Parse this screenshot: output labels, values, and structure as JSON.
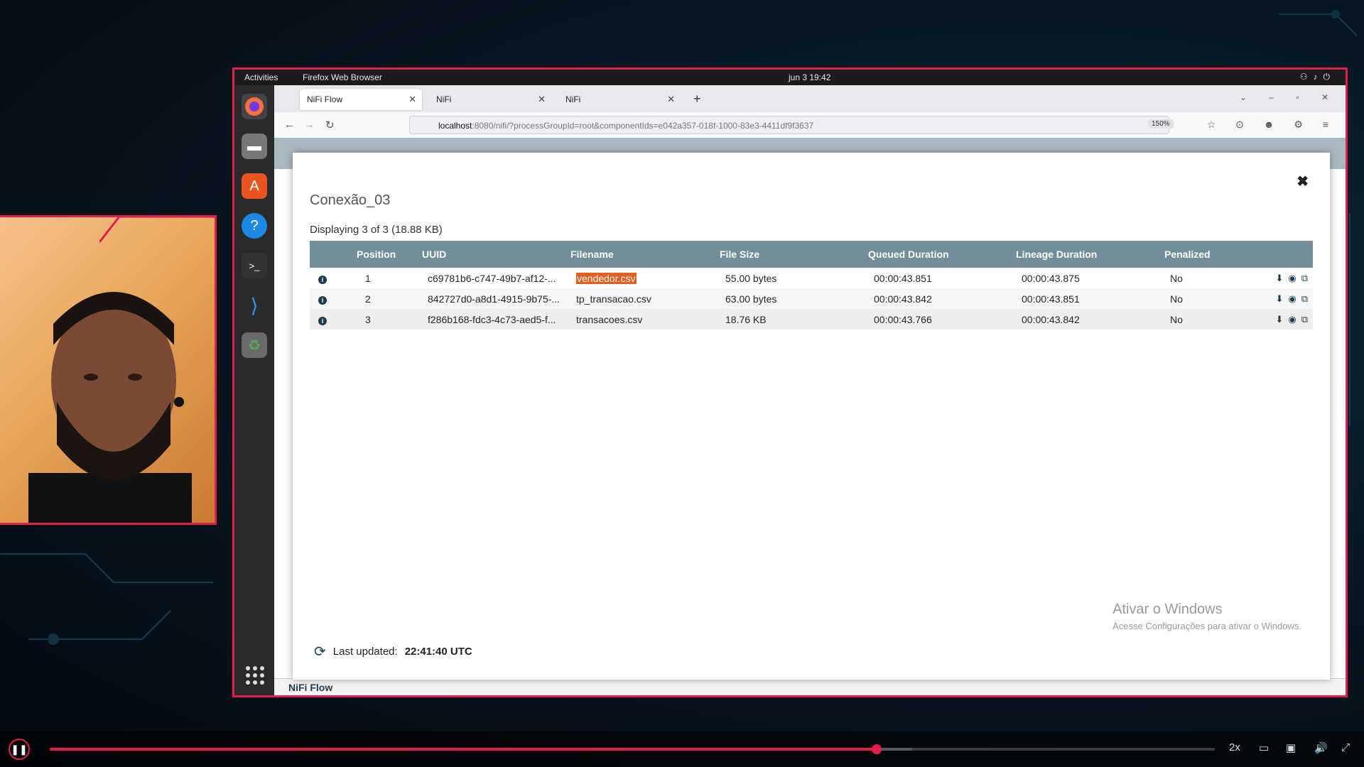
{
  "topbar": {
    "activities": "Activities",
    "app": "Firefox Web Browser",
    "clock": "jun 3  19:42"
  },
  "browser": {
    "tabs": [
      {
        "label": "NiFi Flow"
      },
      {
        "label": "NiFi"
      },
      {
        "label": "NiFi"
      }
    ],
    "url_host": "localhost",
    "url_path": ":8080/nifi/?processGroupId=root&componentIds=e042a357-018f-1000-83e3-4411df9f3637",
    "zoom": "150%"
  },
  "nifi": {
    "footer": "NiFi Flow"
  },
  "dialog": {
    "title": "Conexão_03",
    "summary": "Displaying 3 of 3 (18.88 KB)",
    "columns": [
      "Position",
      "UUID",
      "Filename",
      "File Size",
      "Queued Duration",
      "Lineage Duration",
      "Penalized"
    ],
    "rows": [
      {
        "position": "1",
        "uuid": "c69781b6-c747-49b7-af12-...",
        "filename": "vendedor.csv",
        "size": "55.00 bytes",
        "queued": "00:00:43.851",
        "lineage": "00:00:43.875",
        "penalized": "No"
      },
      {
        "position": "2",
        "uuid": "842727d0-a8d1-4915-9b75-...",
        "filename": "tp_transacao.csv",
        "size": "63.00 bytes",
        "queued": "00:00:43.842",
        "lineage": "00:00:43.851",
        "penalized": "No"
      },
      {
        "position": "3",
        "uuid": "f286b168-fdc3-4c73-aed5-f...",
        "filename": "transacoes.csv",
        "size": "18.76 KB",
        "queued": "00:00:43.766",
        "lineage": "00:00:43.842",
        "penalized": "No"
      }
    ],
    "last_updated_label": "Last updated:",
    "last_updated_value": "22:41:40 UTC"
  },
  "watermark": {
    "line1": "Ativar o Windows",
    "line2": "Acesse Configurações para ativar o Windows."
  },
  "player": {
    "speed": "2x",
    "progress": 0.71,
    "buffered": 0.74
  },
  "colors": {
    "accent": "#e0204a",
    "table_header": "#728e9b",
    "highlight": "#e35e1f"
  }
}
